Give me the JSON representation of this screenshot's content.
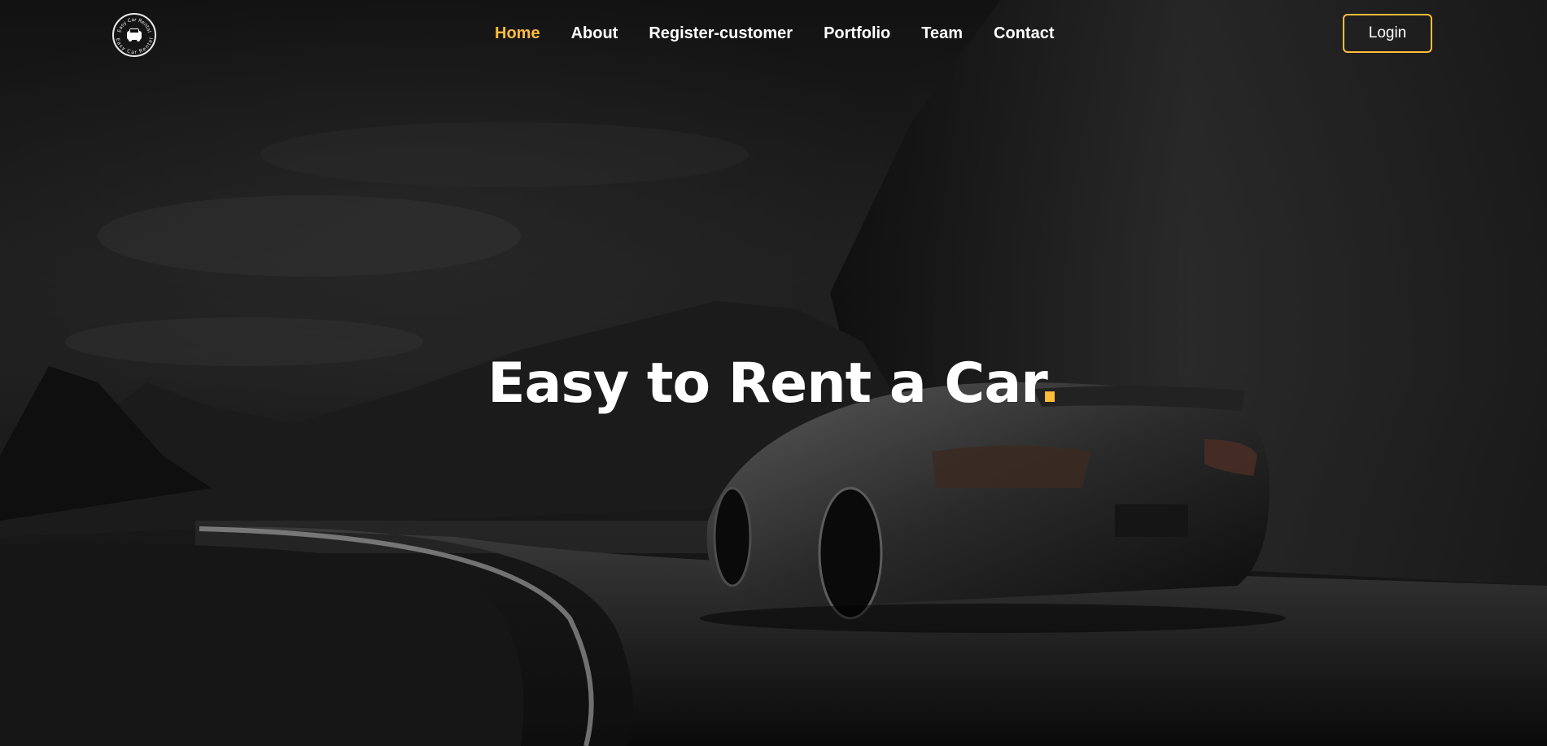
{
  "brand": {
    "logo_text": "Easy Car Rental",
    "icon": "car-icon"
  },
  "nav": {
    "items": [
      {
        "label": "Home",
        "active": true
      },
      {
        "label": "About",
        "active": false
      },
      {
        "label": "Register-customer",
        "active": false
      },
      {
        "label": "Portfolio",
        "active": false
      },
      {
        "label": "Team",
        "active": false
      },
      {
        "label": "Contact",
        "active": false
      }
    ],
    "active_color": "#ffbd3b"
  },
  "login": {
    "label": "Login",
    "border_color": "#ffbd3b"
  },
  "hero": {
    "headline": "Easy to Rent a Car",
    "headline_dot": ".",
    "accent_color": "#ffbd3b",
    "background_image": "dark sports car on a winding mountain road"
  }
}
